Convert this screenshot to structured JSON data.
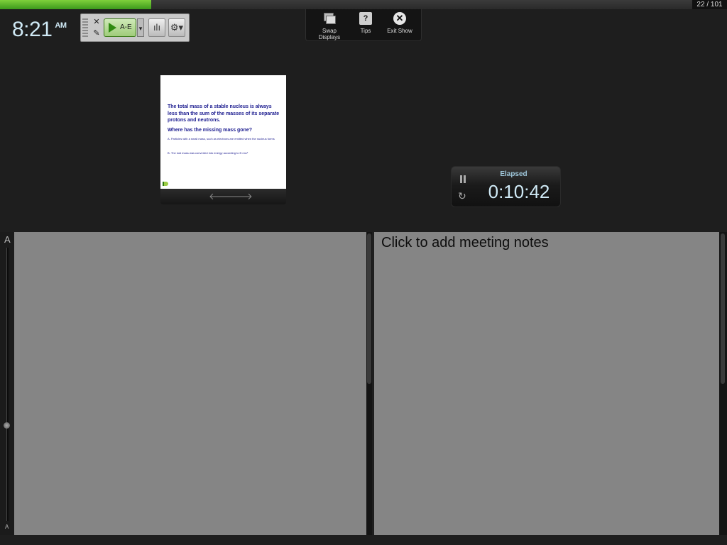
{
  "progress": {
    "fraction": 0.218,
    "counter": "22 / 101"
  },
  "clock": {
    "time": "8:21",
    "ampm": "AM"
  },
  "poll_toolbar": {
    "start_label": "A-E",
    "start_dropdown": "▾",
    "close_glyph": "✕",
    "edit_glyph": "✎",
    "chart_glyph": "ılı",
    "settings_glyph": "⚙▾",
    "icons": [
      "grip-icon",
      "close-icon",
      "edit-icon",
      "play-icon",
      "chart-icon",
      "gear-icon"
    ]
  },
  "show_toolbar": {
    "items": [
      {
        "label": "Swap Displays",
        "icon": "swap-displays-icon"
      },
      {
        "label": "Tips",
        "icon": "tips-icon",
        "glyph": "?"
      },
      {
        "label": "Exit Show",
        "icon": "exit-icon",
        "glyph": "✕"
      }
    ]
  },
  "current_slide": {
    "title": "The total mass of a stable nucleus is always less than the sum of the masses of its separate protons and neutrons.",
    "question": "Where has the missing mass gone?",
    "options": [
      "A.  Particles with a small mass, such as electrons are emitted when the nucleus forms",
      "B.  The lost mass was converted into energy according to E=mc²"
    ],
    "nav": {
      "prev": "🡐",
      "next": "🡒"
    }
  },
  "timer": {
    "label": "Elapsed",
    "value": "0:10:42",
    "reset_glyph": "↻"
  },
  "font_slider": {
    "large_label": "A",
    "small_label": "A",
    "level": 0.35
  },
  "meeting_notes": {
    "placeholder": "Click to add meeting notes"
  },
  "colors": {
    "progress": "#56b52a",
    "background": "#1e1e1e",
    "notes_bg": "#858585",
    "clock": "#cfe9f5"
  }
}
